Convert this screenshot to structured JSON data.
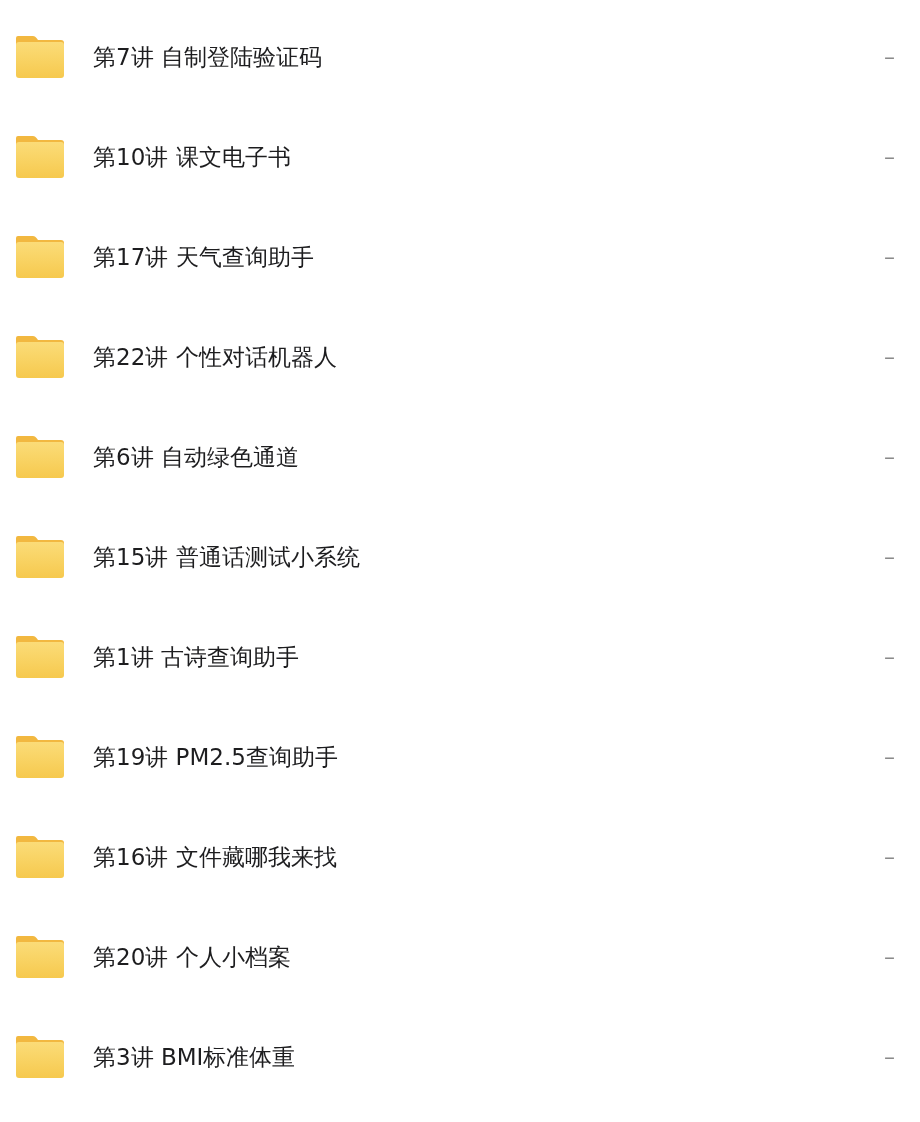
{
  "folders": [
    {
      "name": "第7讲 自制登陆验证码",
      "size": "–"
    },
    {
      "name": "第10讲 课文电子书",
      "size": "–"
    },
    {
      "name": "第17讲 天气查询助手",
      "size": "–"
    },
    {
      "name": "第22讲 个性对话机器人",
      "size": "–"
    },
    {
      "name": "第6讲 自动绿色通道",
      "size": "–"
    },
    {
      "name": "第15讲 普通话测试小系统",
      "size": "–"
    },
    {
      "name": "第1讲 古诗查询助手",
      "size": "–"
    },
    {
      "name": "第19讲 PM2.5查询助手",
      "size": "–"
    },
    {
      "name": "第16讲 文件藏哪我来找",
      "size": "–"
    },
    {
      "name": "第20讲 个人小档案",
      "size": "–"
    },
    {
      "name": "第3讲 BMI标准体重",
      "size": "–"
    }
  ]
}
